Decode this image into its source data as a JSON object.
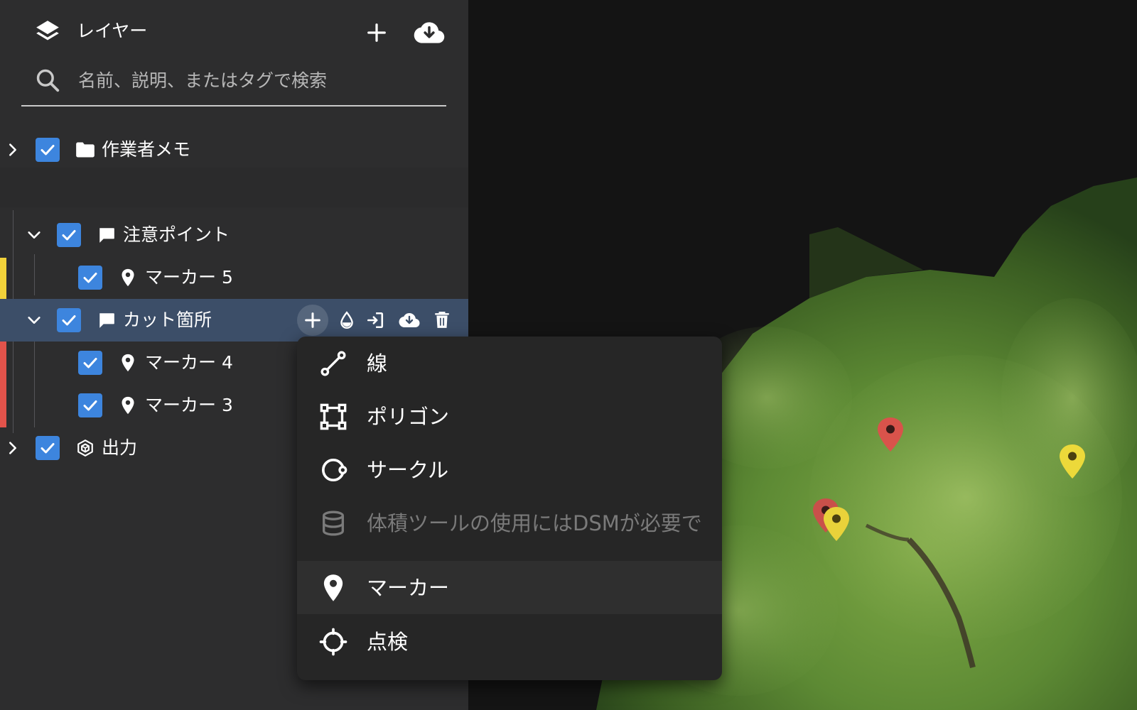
{
  "panel": {
    "title": "レイヤー",
    "search_placeholder": "名前、説明、またはタグで検索"
  },
  "tree": [
    {
      "label": "作業者メモ",
      "icon": "folder-icon",
      "expanded": false,
      "checked": true
    },
    {
      "label": "注意ポイント",
      "icon": "comment-icon",
      "expanded": true,
      "checked": true
    },
    {
      "label": "マーカー 5",
      "icon": "map-pin-icon",
      "checked": true,
      "color": "#f2d23a"
    },
    {
      "label": "カット箇所",
      "icon": "comment-icon",
      "expanded": true,
      "checked": true,
      "selected": true
    },
    {
      "label": "マーカー 4",
      "icon": "map-pin-icon",
      "checked": true,
      "color": "#e2534b"
    },
    {
      "label": "マーカー 3",
      "icon": "map-pin-icon",
      "checked": true,
      "color": "#e2534b"
    },
    {
      "label": "出力",
      "icon": "cube-icon",
      "expanded": false,
      "checked": true
    }
  ],
  "row_actions": [
    "add-icon",
    "droplet-icon",
    "import-icon",
    "cloud-download-icon",
    "trash-icon"
  ],
  "menu": [
    {
      "label": "線",
      "icon": "line-icon"
    },
    {
      "label": "ポリゴン",
      "icon": "polygon-icon"
    },
    {
      "label": "サークル",
      "icon": "circle-icon"
    },
    {
      "label": "体積ツールの使用にはDSMが必要で",
      "icon": "volume-cylinder-icon",
      "disabled": true
    },
    {
      "label": "マーカー",
      "icon": "map-pin-icon",
      "hover": true
    },
    {
      "label": "点検",
      "icon": "crosshair-icon"
    }
  ],
  "colors": {
    "accent": "#3d85de",
    "selected_row": "#3c4e68",
    "marker_yellow": "#f2d23a",
    "marker_red": "#e2534b"
  }
}
